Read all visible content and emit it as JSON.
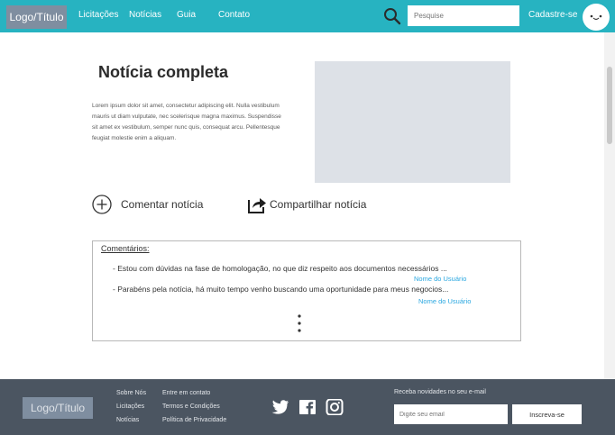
{
  "header": {
    "logo": "Logo/Título",
    "nav": [
      "Licitações",
      "Notícias",
      "Guia",
      "Contato"
    ],
    "search_placeholder": "Pesquise",
    "signup": "Cadastre-se"
  },
  "article": {
    "title": "Notícia completa",
    "body": "Lorem ipsum dolor sit amet, consectetur adipiscing elit. Nulla vestibulum mauris ut diam vulputate, nec scelerisque magna maximus. Suspendisse sit amet ex vestibulum, semper nunc quis, consequat arcu. Pellentesque feugiat molestie enim a aliquam.",
    "comment_label": "Comentar notícia",
    "share_label": "Compartilhar notícia"
  },
  "comments": {
    "title": "Comentários:",
    "items": [
      {
        "text": "- Estou com dúvidas na fase de homologação, no que diz respeito aos documentos necessários ...",
        "user": "Nome do Usuário"
      },
      {
        "text": "- Parabéns pela notícia, há muito tempo venho buscando uma oportunidade para meus negocios...",
        "user": "Nome do Usuário"
      }
    ]
  },
  "footer": {
    "logo": "Logo/Título",
    "col1": [
      "Sobre Nós",
      "Licitações",
      "Notícias"
    ],
    "col2": [
      "Entre em contato",
      "Termos e Condições",
      "Política de Privacidade"
    ],
    "social_icons": [
      "twitter-icon",
      "facebook-icon",
      "instagram-icon"
    ],
    "newsletter_label": "Receba novidades no seu e-mail",
    "newsletter_placeholder": "Digite seu email",
    "subscribe": "Inscreva-se"
  },
  "colors": {
    "header": "#27b3c1",
    "footer": "#4b5561",
    "logo_box": "#7f8ea0",
    "link_blue": "#2aa7e0"
  }
}
